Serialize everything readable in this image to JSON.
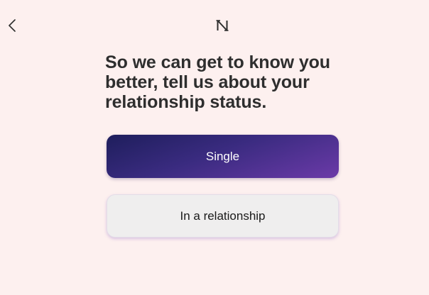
{
  "header": {
    "back_icon": "chevron-left-icon",
    "logo_icon": "brand-logo-icon"
  },
  "main": {
    "title": "So we can get to know you better, tell us about your relationship status.",
    "options": [
      {
        "label": "Single",
        "selected": true
      },
      {
        "label": "In a relationship",
        "selected": false
      }
    ]
  },
  "colors": {
    "background": "#fdf0ef",
    "text": "#2e2e2e",
    "selected_gradient_start": "#1e1e5c",
    "selected_gradient_end": "#6b3aa8",
    "unselected_background": "#efeeee"
  }
}
